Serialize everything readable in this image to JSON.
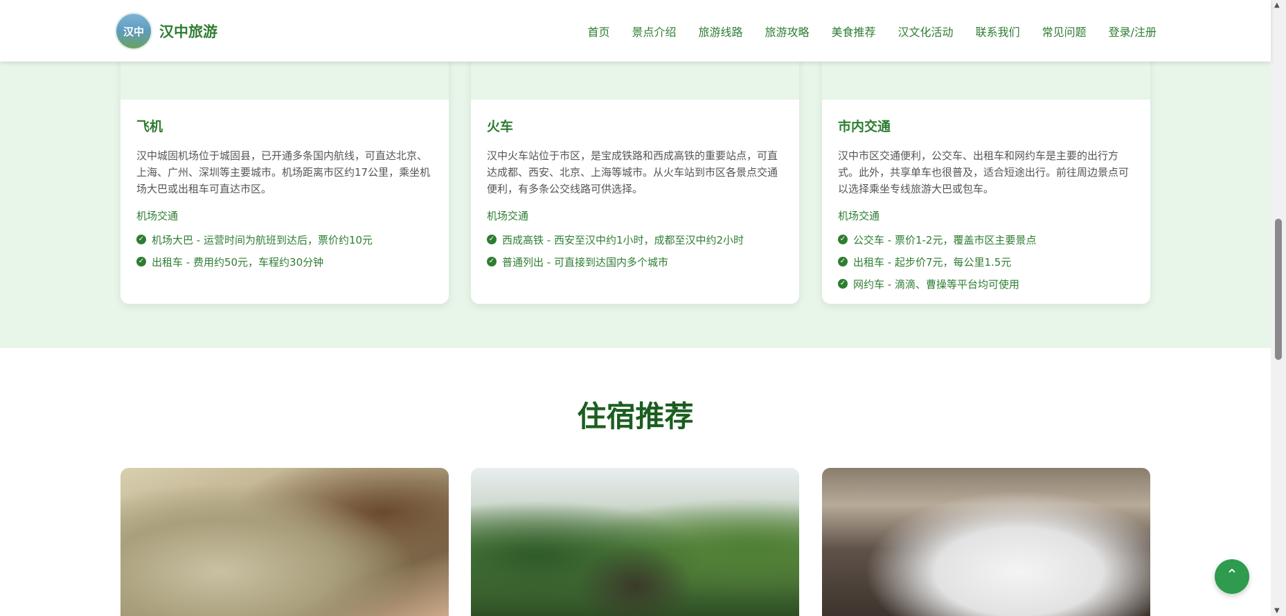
{
  "header": {
    "logo_badge": "汉中",
    "logo_text": "汉中旅游",
    "nav": [
      "首页",
      "景点介绍",
      "旅游线路",
      "旅游攻略",
      "美食推荐",
      "汉文化活动",
      "联系我们",
      "常见问题",
      "登录/注册"
    ]
  },
  "transport": {
    "cards": [
      {
        "title": "飞机",
        "desc": "汉中城固机场位于城固县，已开通多条国内航线，可直达北京、上海、广州、深圳等主要城市。机场距离市区约17公里，乘坐机场大巴或出租车可直达市区。",
        "sub": "机场交通",
        "items": [
          "机场大巴 - 运营时间为航班到达后，票价约10元",
          "出租车 - 费用约50元，车程约30分钟"
        ]
      },
      {
        "title": "火车",
        "desc": "汉中火车站位于市区，是宝成铁路和西成高铁的重要站点，可直达成都、西安、北京、上海等城市。从火车站到市区各景点交通便利，有多条公交线路可供选择。",
        "sub": "机场交通",
        "items": [
          "西成高铁 - 西安至汉中约1小时，成都至汉中约2小时",
          "普通列出 - 可直接到达国内多个城市"
        ]
      },
      {
        "title": "市内交通",
        "desc": "汉中市区交通便利，公交车、出租车和网约车是主要的出行方式。此外，共享单车也很普及，适合短途出行。前往周边景点可以选择乘坐专线旅游大巴或包车。",
        "sub": "机场交通",
        "items": [
          "公交车 - 票价1-2元，覆盖市区主要景点",
          "出租车 - 起步价7元，每公里1.5元",
          "网约车 - 滴滴、曹操等平台均可使用"
        ]
      }
    ]
  },
  "lodging": {
    "title": "住宿推荐"
  },
  "colors": {
    "brand_green": "#2e7d32",
    "section_bg": "#e8f5e9",
    "to_top_button": "#2e9b4f"
  },
  "icons": {
    "check": "check-circle-icon",
    "to_top": "arrow-up-icon"
  }
}
